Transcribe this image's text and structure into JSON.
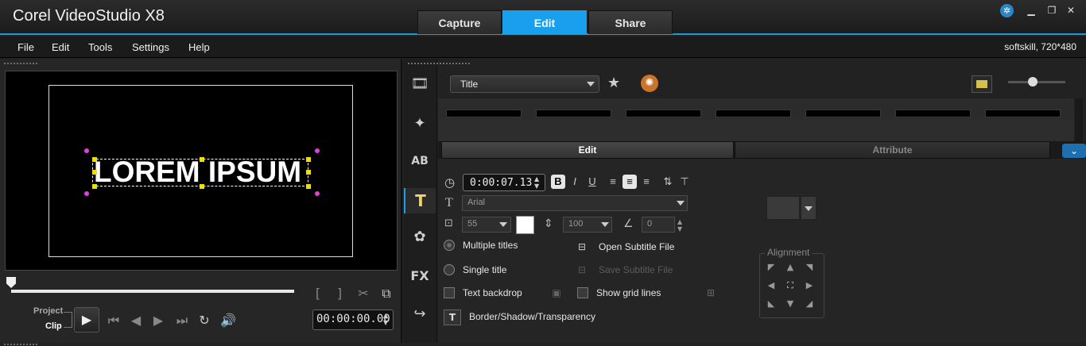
{
  "app": {
    "title": "Corel VideoStudio X8"
  },
  "main_tabs": [
    {
      "label": "Capture",
      "active": false
    },
    {
      "label": "Edit",
      "active": true
    },
    {
      "label": "Share",
      "active": false
    }
  ],
  "menu": {
    "items": [
      "File",
      "Edit",
      "Tools",
      "Settings",
      "Help"
    ],
    "project_info": "softskill, 720*480"
  },
  "preview": {
    "title_text": "LOREM IPSUM",
    "project_label": "Project",
    "clip_label": "Clip",
    "timecode": "00:00:00.00"
  },
  "library": {
    "selected": "Title"
  },
  "options": {
    "tabs": [
      "Edit",
      "Attribute"
    ],
    "duration": "0:00:07.13",
    "font": "Arial",
    "font_size": "55",
    "line_spacing": "100",
    "angle": "0",
    "multiple_titles": "Multiple titles",
    "single_title": "Single title",
    "text_backdrop": "Text backdrop",
    "open_subtitle": "Open Subtitle File",
    "save_subtitle": "Save Subtitle File",
    "show_grid": "Show grid lines",
    "border_shadow": "Border/Shadow/Transparency",
    "alignment_label": "Alignment",
    "format_bold": "B",
    "format_italic": "I",
    "format_underline": "U"
  },
  "colors": {
    "accent": "#18a0ef",
    "title_color": "#ffffff"
  }
}
